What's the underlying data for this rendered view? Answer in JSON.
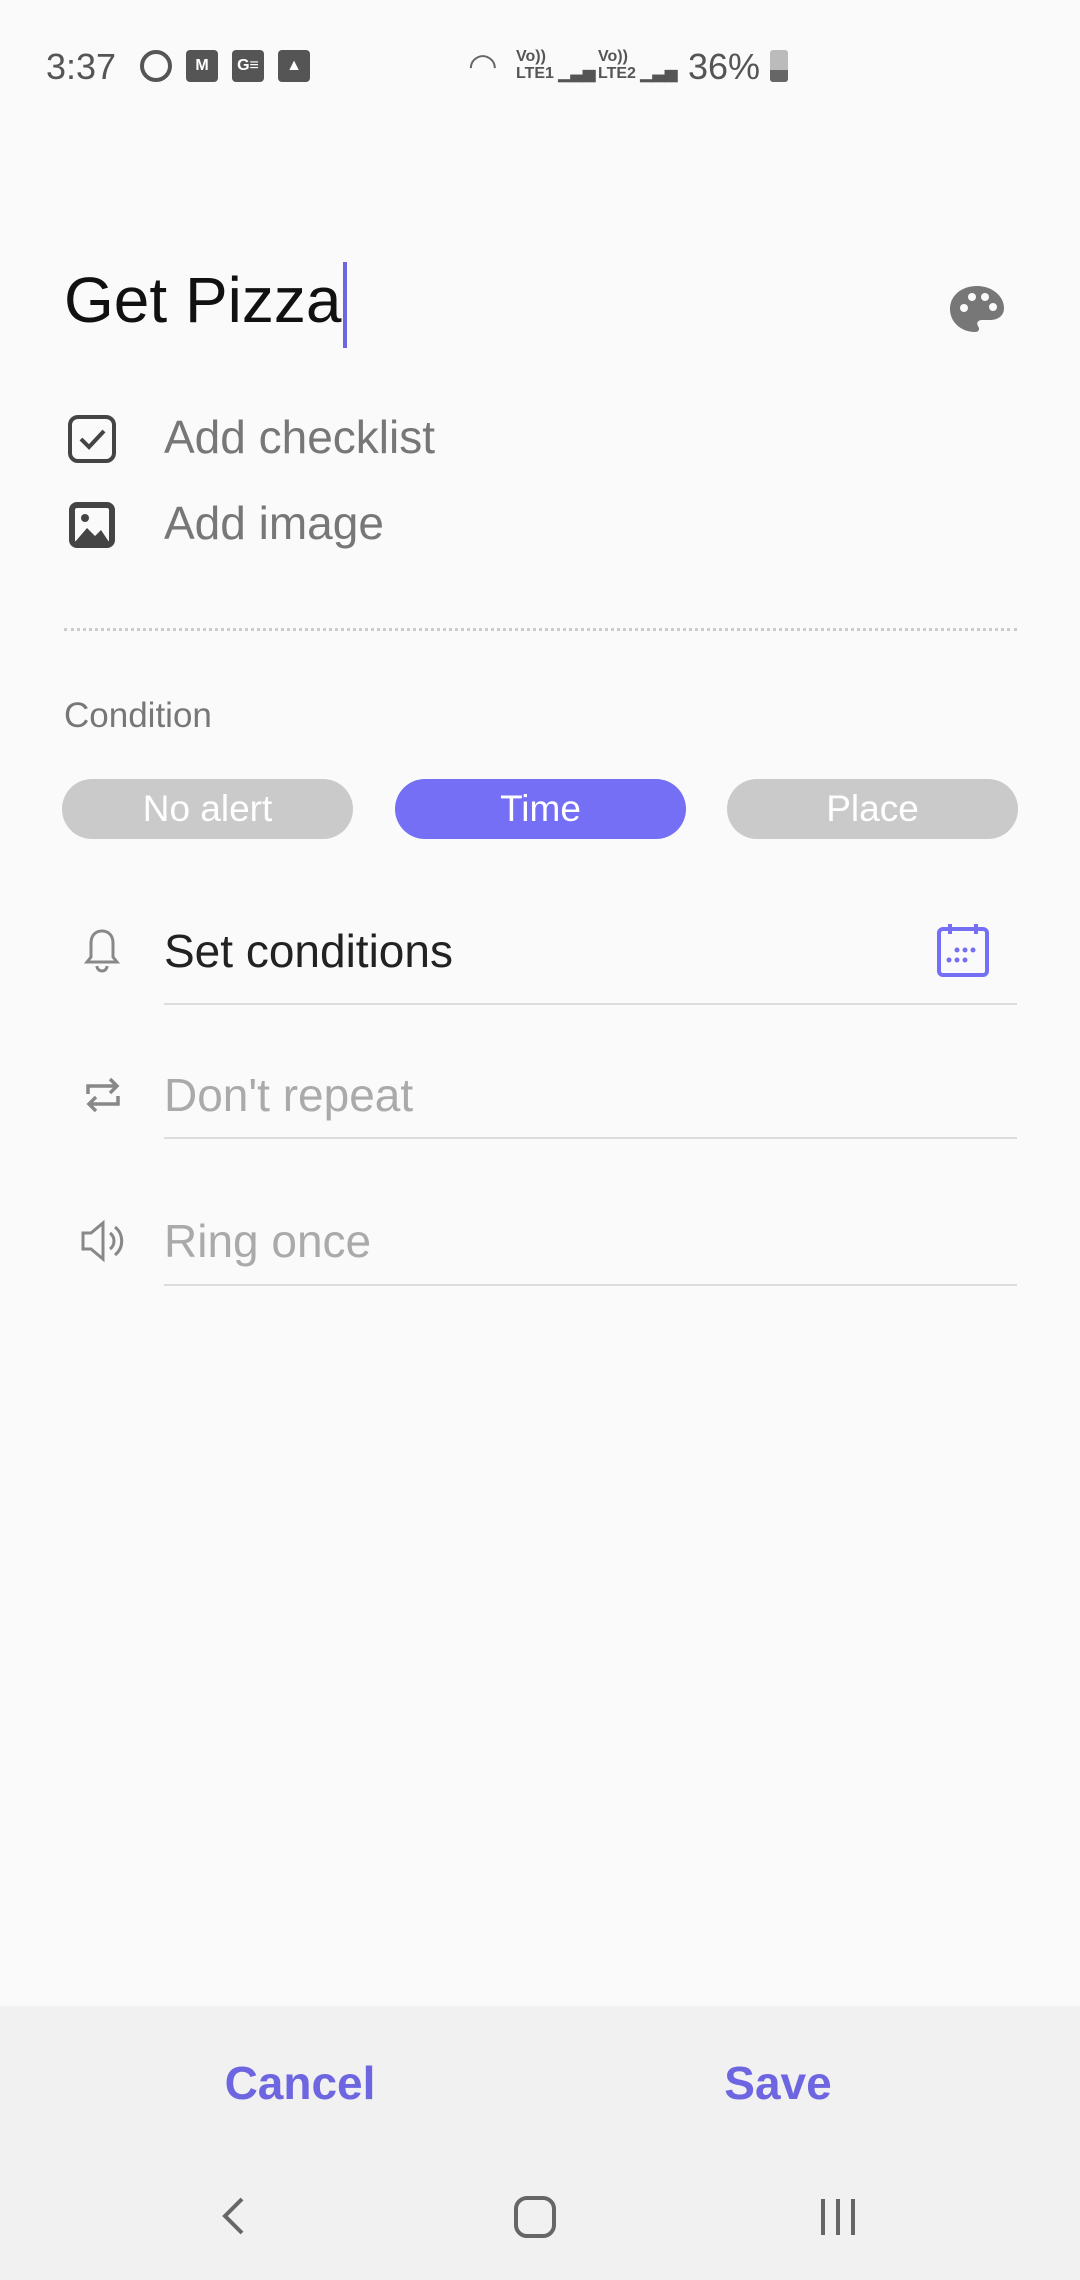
{
  "status_bar": {
    "time": "3:37",
    "battery": "36%",
    "battery_level": 36,
    "notification_icons": [
      "account-icon",
      "gmail-icon",
      "ge-icon",
      "gallery-icon"
    ],
    "network": [
      "wifi-icon",
      "LTE1",
      "LTE2"
    ]
  },
  "editor": {
    "title": "Get Pizza",
    "add_checklist": "Add checklist",
    "add_image": "Add image"
  },
  "condition": {
    "label": "Condition",
    "options": [
      "No alert",
      "Time",
      "Place"
    ],
    "selected": "Time"
  },
  "fields": {
    "set_conditions": "Set conditions",
    "repeat": "Don't repeat",
    "ring": "Ring once"
  },
  "actions": {
    "cancel": "Cancel",
    "save": "Save"
  },
  "colors": {
    "accent": "#746ff5",
    "pill_inactive": "#cacaca"
  }
}
